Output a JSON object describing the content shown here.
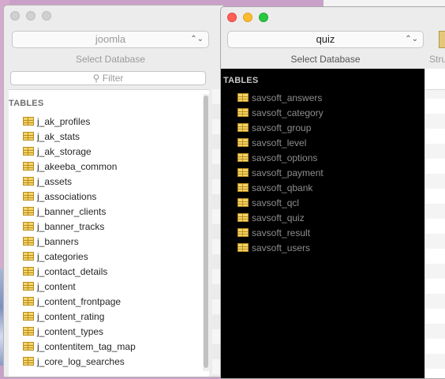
{
  "back_window": {
    "database": "joomla",
    "select_label": "Select Database",
    "filter_placeholder": "Filter",
    "tables_heading": "TABLES",
    "tables": [
      "j_ak_profiles",
      "j_ak_stats",
      "j_ak_storage",
      "j_akeeba_common",
      "j_assets",
      "j_associations",
      "j_banner_clients",
      "j_banner_tracks",
      "j_banners",
      "j_categories",
      "j_contact_details",
      "j_content",
      "j_content_frontpage",
      "j_content_rating",
      "j_content_types",
      "j_contentitem_tag_map",
      "j_core_log_searches"
    ]
  },
  "front_window": {
    "database": "quiz",
    "select_label": "Select Database",
    "tables_heading": "TABLES",
    "tables": [
      "savsoft_answers",
      "savsoft_category",
      "savsoft_group",
      "savsoft_level",
      "savsoft_options",
      "savsoft_payment",
      "savsoft_qbank",
      "savsoft_qcl",
      "savsoft_quiz",
      "savsoft_result",
      "savsoft_users"
    ],
    "structure_label": "Stru"
  },
  "colors": {
    "close": "#fe5f57",
    "minimize": "#febc2e",
    "zoom": "#28c840",
    "table_icon": "#f3d46a"
  },
  "icons": {
    "table": "table-icon",
    "search": "search-icon",
    "chevron": "chevron-updown-icon"
  }
}
